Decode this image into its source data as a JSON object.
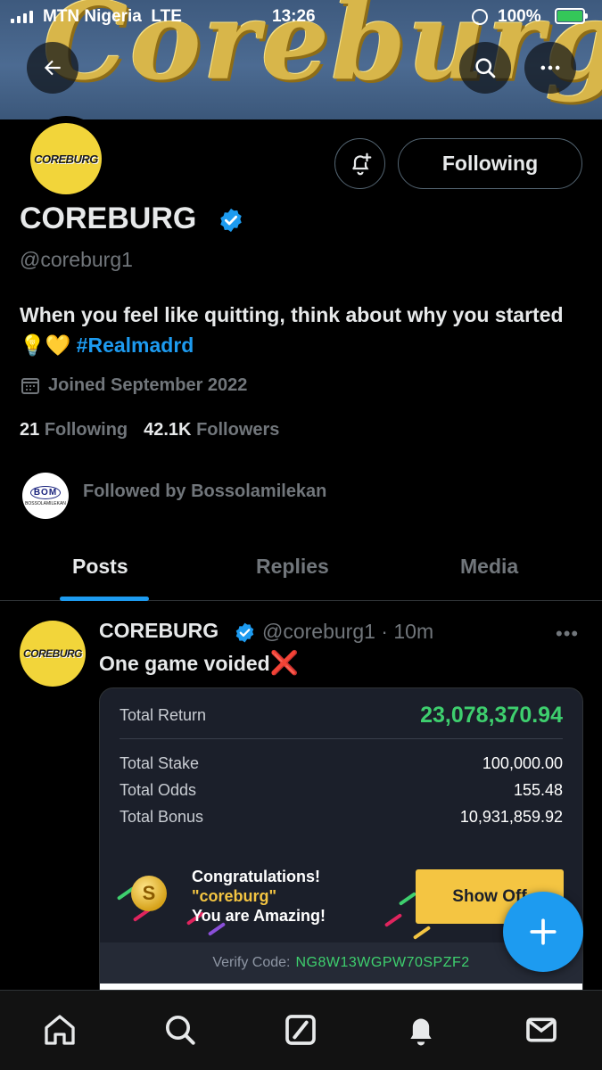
{
  "status_bar": {
    "carrier": "MTN Nigeria",
    "network": "LTE",
    "time": "13:26",
    "battery": "100%"
  },
  "banner": {
    "text": "Coreburg"
  },
  "header": {
    "back_icon": "arrow-left-icon",
    "search_icon": "search-icon",
    "more_icon": "more-horizontal-icon"
  },
  "profile": {
    "avatar_text": "COREBURG",
    "display_name": "COREBURG",
    "handle": "@coreburg1",
    "bio_text": "When you feel like quitting, think about why you started 💡💛",
    "bio_hashtag": "#Realmadrd",
    "joined": "Joined September 2022",
    "following_count": "21",
    "following_label": "Following",
    "followers_count": "42.1K",
    "followers_label": "Followers",
    "followed_by": "Followed by Bossolamilekan",
    "followed_avatar_text": "BOM",
    "followed_avatar_sub": "BOSSOLAMILEKAN",
    "following_button": "Following"
  },
  "tabs": [
    {
      "label": "Posts",
      "active": true
    },
    {
      "label": "Replies",
      "active": false
    },
    {
      "label": "Media",
      "active": false
    }
  ],
  "post": {
    "author": "COREBURG",
    "handle_time": "@coreburg1 · 10m",
    "text": "One game voided",
    "text_emoji": "❌",
    "avatar_text": "COREBURG"
  },
  "ticket": {
    "total_return_label": "Total Return",
    "total_return_value": "23,078,370.94",
    "total_stake_label": "Total Stake",
    "total_stake_value": "100,000.00",
    "total_odds_label": "Total Odds",
    "total_odds_value": "155.48",
    "total_bonus_label": "Total Bonus",
    "total_bonus_value": "10,931,859.92",
    "congrats_line1": "Congratulations!",
    "congrats_user": "\"coreburg\"",
    "congrats_line3": "You are Amazing!",
    "coin_symbol": "S",
    "show_off_label": "Show Off",
    "verify_label": "Verify Code:",
    "verify_code": "NG8W13WGPW70SPZF2"
  },
  "bottom_nav": [
    "home-icon",
    "search-icon",
    "grok-icon",
    "notifications-icon",
    "messages-icon"
  ],
  "colors": {
    "accent": "#1d9bf0",
    "green": "#3ecf6e",
    "gold": "#f4c542"
  }
}
